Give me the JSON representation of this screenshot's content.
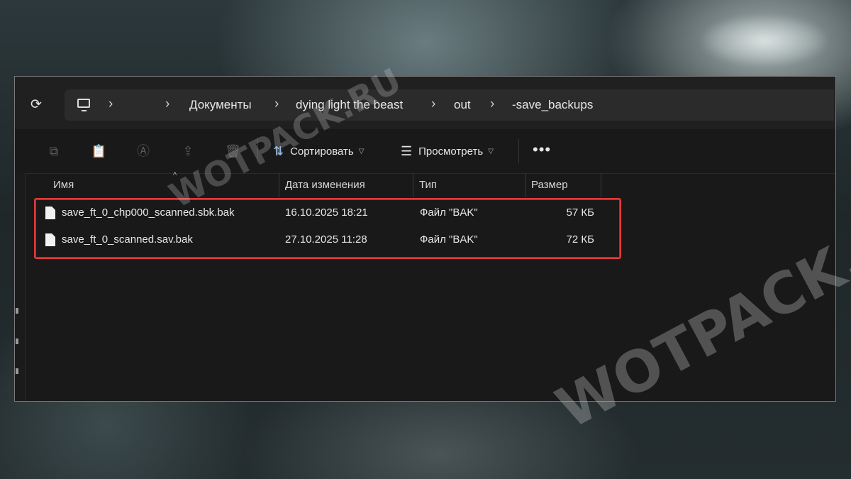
{
  "breadcrumb": {
    "items": [
      "Документы",
      "dying light the beast",
      "out",
      "-save_backups"
    ],
    "separator": "›"
  },
  "toolbar": {
    "sort_label": "Сортировать",
    "view_label": "Просмотреть",
    "more_label": "•••"
  },
  "columns": {
    "name": "Имя",
    "date": "Дата изменения",
    "type": "Тип",
    "size": "Размер"
  },
  "files": [
    {
      "name": "save_ft_0_chp000_scanned.sbk.bak",
      "date": "16.10.2025 18:21",
      "type": "Файл \"BAK\"",
      "size": "57 КБ"
    },
    {
      "name": "save_ft_0_scanned.sav.bak",
      "date": "27.10.2025 11:28",
      "type": "Файл \"BAK\"",
      "size": "72 КБ"
    }
  ],
  "watermark": "WOTPACK.RU",
  "colors": {
    "highlight": "#e23a3a",
    "window_bg": "#191919",
    "accent_icon": "#8fb8e8"
  }
}
